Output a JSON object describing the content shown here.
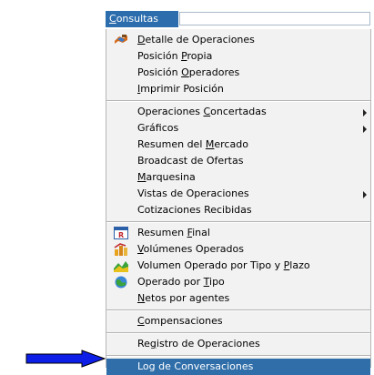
{
  "menubar": {
    "title_prefix": "C",
    "title_rest": "onsultas"
  },
  "menu": {
    "items": [
      {
        "label_pre": "",
        "label_u": "D",
        "label_post": "etalle de Operaciones",
        "icon": "operations-icon"
      },
      {
        "label_pre": "Posición ",
        "label_u": "P",
        "label_post": "ropia"
      },
      {
        "label_pre": "Posición ",
        "label_u": "O",
        "label_post": "peradores"
      },
      {
        "label_pre": "",
        "label_u": "I",
        "label_post": "mprimir Posición"
      },
      {
        "label_pre": "Operaciones ",
        "label_u": "C",
        "label_post": "oncertadas",
        "submenu": true
      },
      {
        "label_pre": "Gráficos",
        "label_u": "",
        "label_post": "",
        "submenu": true
      },
      {
        "label_pre": "Resumen del ",
        "label_u": "M",
        "label_post": "ercado"
      },
      {
        "label_pre": "Broadcast de Ofertas",
        "label_u": "",
        "label_post": ""
      },
      {
        "label_pre": "",
        "label_u": "M",
        "label_post": "arquesina"
      },
      {
        "label_pre": "Vistas de Operaciones",
        "label_u": "",
        "label_post": "",
        "submenu": true
      },
      {
        "label_pre": "Cotizaciones Recibidas",
        "label_u": "",
        "label_post": ""
      },
      {
        "label_pre": "Resumen ",
        "label_u": "F",
        "label_post": "inal",
        "icon": "summary-r-icon"
      },
      {
        "label_pre": "",
        "label_u": "V",
        "label_post": "olúmenes Operados",
        "icon": "volume-bars-icon"
      },
      {
        "label_pre": "Volumen Operado por Tipo y ",
        "label_u": "P",
        "label_post": "lazo",
        "icon": "volume-type-icon"
      },
      {
        "label_pre": "Operado por ",
        "label_u": "T",
        "label_post": "ipo",
        "icon": "globe-icon"
      },
      {
        "label_pre": "",
        "label_u": "N",
        "label_post": "etos por agentes"
      },
      {
        "label_pre": "",
        "label_u": "C",
        "label_post": "ompensaciones"
      },
      {
        "label_pre": "Re",
        "label_u": "g",
        "label_post": "istro de Operaciones"
      },
      {
        "label_pre": "Log de Conversaciones",
        "label_u": "",
        "label_post": "",
        "selected": true
      }
    ]
  },
  "colors": {
    "accent": "#2b6dad",
    "selected": "#2f6ea9",
    "pointer": "#0d1ee6",
    "menu_bg": "#f2f2f2"
  }
}
